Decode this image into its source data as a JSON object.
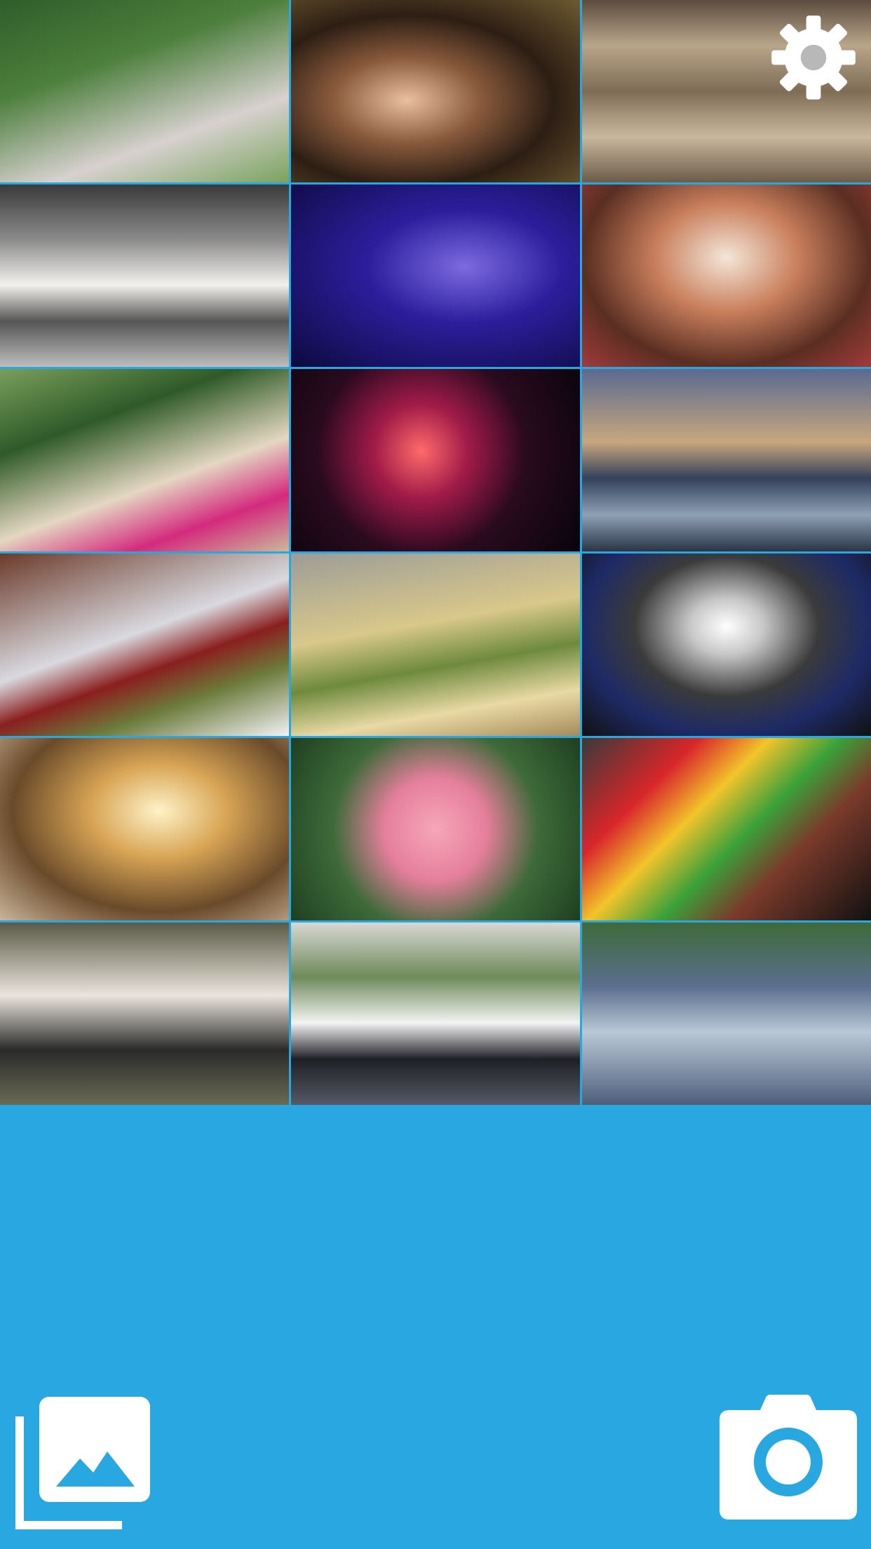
{
  "theme": {
    "background": "#28a7e0",
    "icon_color": "#ffffff"
  },
  "icons": {
    "settings": "gear-icon",
    "gallery": "photo-gallery-icon",
    "camera": "camera-icon"
  }
}
